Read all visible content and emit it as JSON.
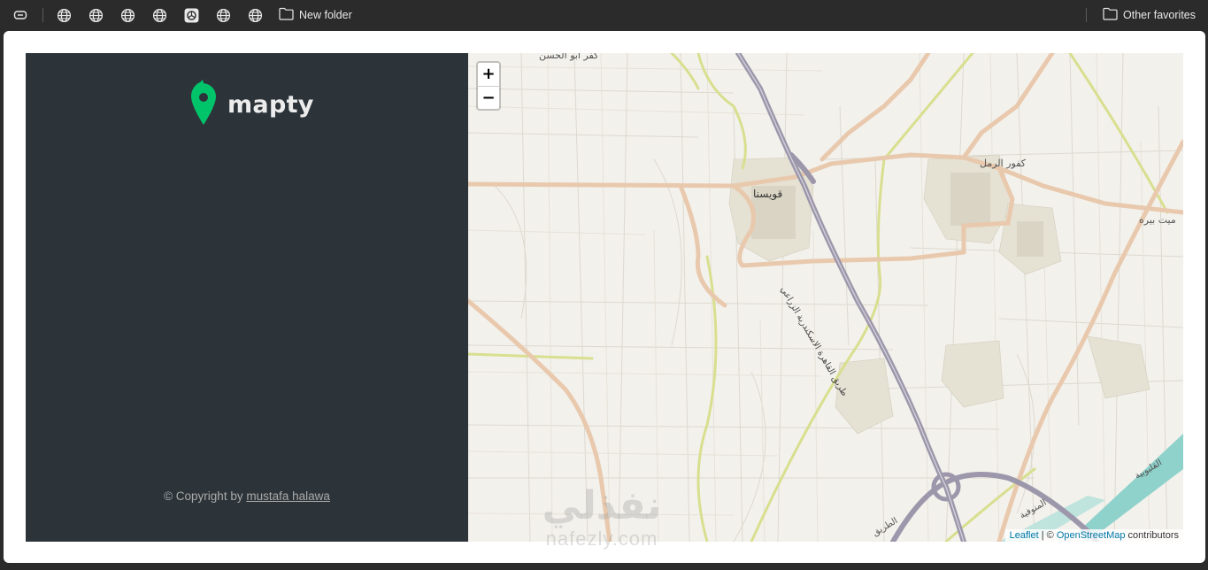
{
  "favorites_bar": {
    "items": [
      {
        "icon": "tab-icon"
      },
      {
        "icon": "globe-icon"
      },
      {
        "icon": "globe-icon"
      },
      {
        "icon": "globe-icon"
      },
      {
        "icon": "globe-icon"
      },
      {
        "icon": "chatgpt-icon"
      },
      {
        "icon": "globe-icon"
      },
      {
        "icon": "globe-icon"
      }
    ],
    "new_folder_label": "New folder",
    "other_favorites_label": "Other favorites"
  },
  "sidebar": {
    "logo_text": "mapty",
    "logo_color": "#00c46a",
    "copyright_prefix": "© Copyright by ",
    "copyright_author": "mustafa halawa"
  },
  "map": {
    "zoom_in_label": "+",
    "zoom_out_label": "−",
    "attribution": {
      "leaflet": "Leaflet",
      "separator": " | © ",
      "osm": "OpenStreetMap",
      "suffix": " contributors"
    },
    "places": {
      "town_main": "قويسنا",
      "town_ne": "كفور الرمل",
      "town_e": "ميت بيره",
      "village_top": "كفر ابو الحسن",
      "highway": "طريق القاهرة الاسكندرية الزراعي",
      "highway_bottom": "الطريق",
      "region_q": "القليوبية",
      "region_m": "المنوفية"
    },
    "colors": {
      "background": "#f3f1ec",
      "primary_road": "#e9c9ad",
      "secondary_road": "#d8df8f",
      "motorway": "#9c97ab",
      "water": "#8fd2cb"
    }
  },
  "watermark": {
    "arabic": "نفذلي",
    "latin": "nafezly.com"
  }
}
